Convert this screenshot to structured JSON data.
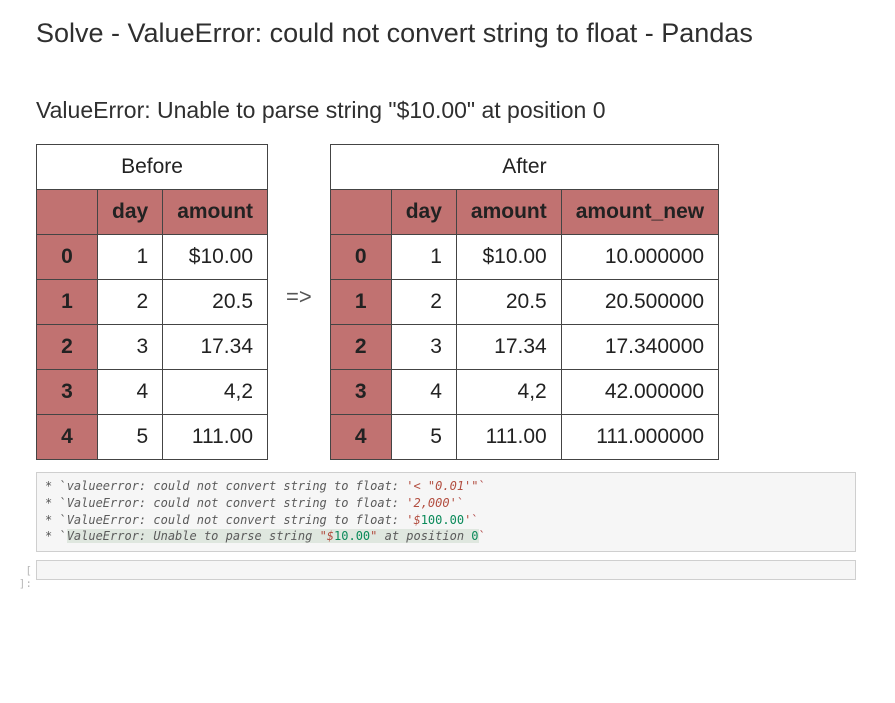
{
  "title": "Solve - ValueError: could not convert string to float - Pandas",
  "subtitle": "ValueError: Unable to parse string \"$10.00\" at position 0",
  "arrow": "=>",
  "before": {
    "caption": "Before",
    "columns": [
      "day",
      "amount"
    ],
    "rows": [
      {
        "idx": "0",
        "day": "1",
        "amount": "$10.00"
      },
      {
        "idx": "1",
        "day": "2",
        "amount": "20.5"
      },
      {
        "idx": "2",
        "day": "3",
        "amount": "17.34"
      },
      {
        "idx": "3",
        "day": "4",
        "amount": "4,2"
      },
      {
        "idx": "4",
        "day": "5",
        "amount": "111.00"
      }
    ]
  },
  "after": {
    "caption": "After",
    "columns": [
      "day",
      "amount",
      "amount_new"
    ],
    "rows": [
      {
        "idx": "0",
        "day": "1",
        "amount": "$10.00",
        "amount_new": "10.000000"
      },
      {
        "idx": "1",
        "day": "2",
        "amount": "20.5",
        "amount_new": "20.500000"
      },
      {
        "idx": "2",
        "day": "3",
        "amount": "17.34",
        "amount_new": "17.340000"
      },
      {
        "idx": "3",
        "day": "4",
        "amount": "4,2",
        "amount_new": "42.000000"
      },
      {
        "idx": "4",
        "day": "5",
        "amount": "111.00",
        "amount_new": "111.000000"
      }
    ]
  },
  "errors": {
    "l1_a": "* `",
    "l1_b": "valueerror: could not convert string to float: ",
    "l1_c": "'< \"0.01'\"",
    "l1_d": "`",
    "l2_a": "* `",
    "l2_b": "ValueError: could not convert string to float: ",
    "l2_c": "'2,000'",
    "l2_d": "`",
    "l3_a": "* `",
    "l3_b": "ValueError: could not convert string to float: ",
    "l3_c": "'$",
    "l3_d": "100.00",
    "l3_e": "'",
    "l3_f": "`",
    "l4_a": "* `",
    "l4_b": "ValueError: Unable to parse string ",
    "l4_c": "\"$",
    "l4_d": "10.00",
    "l4_e": "\"",
    "l4_f": " at position ",
    "l4_g": "0",
    "l4_h": "`"
  },
  "prompt": "[ ]:"
}
